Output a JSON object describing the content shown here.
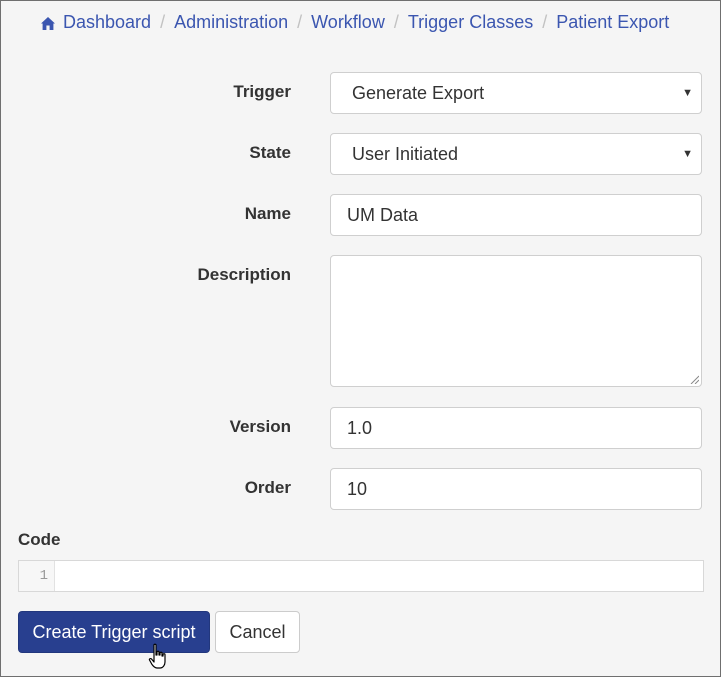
{
  "breadcrumb": {
    "items": [
      "Dashboard",
      "Administration",
      "Workflow",
      "Trigger Classes",
      "Patient Export"
    ],
    "separator": "/"
  },
  "form": {
    "trigger": {
      "label": "Trigger",
      "value": "Generate Export"
    },
    "state": {
      "label": "State",
      "value": "User Initiated"
    },
    "name": {
      "label": "Name",
      "value": "UM Data"
    },
    "description": {
      "label": "Description",
      "value": ""
    },
    "version": {
      "label": "Version",
      "value": "1.0"
    },
    "order": {
      "label": "Order",
      "value": "10"
    }
  },
  "code": {
    "label": "Code",
    "line_number": "1",
    "content": ""
  },
  "buttons": {
    "create_label": "Create Trigger script",
    "cancel_label": "Cancel"
  },
  "colors": {
    "link": "#3b56b0",
    "primary_button": "#283f8f",
    "panel_background": "#f5f5f5"
  },
  "icons": {
    "home": "home-icon",
    "dropdown": "caret-down-icon",
    "cursor": "hand-pointer-icon"
  }
}
